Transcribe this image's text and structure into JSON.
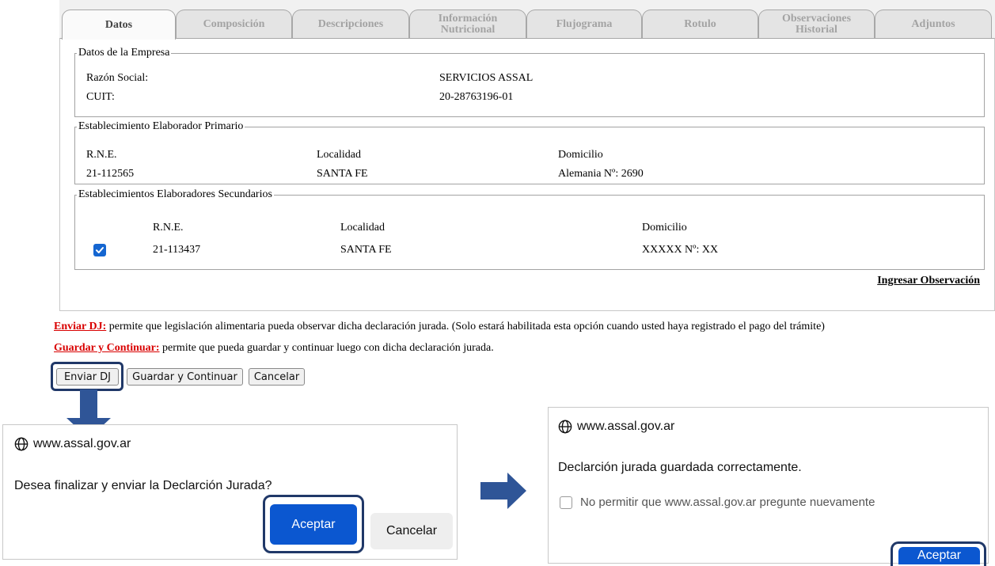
{
  "tabs": [
    {
      "label": "Datos",
      "active": true
    },
    {
      "label": "Composición"
    },
    {
      "label": "Descripciones"
    },
    {
      "label_line1": "Información",
      "label_line2": "Nutricional"
    },
    {
      "label": "Flujograma"
    },
    {
      "label": "Rotulo"
    },
    {
      "label_line1": "Observaciones",
      "label_line2": "Historial"
    },
    {
      "label": "Adjuntos"
    }
  ],
  "empresa": {
    "legend": "Datos de la Empresa",
    "razon_social_label": "Razón Social:",
    "razon_social_value": "SERVICIOS ASSAL",
    "cuit_label": "CUIT:",
    "cuit_value": "20-28763196-01"
  },
  "primario": {
    "legend": "Establecimiento Elaborador Primario",
    "headers": {
      "rne": "R.N.E.",
      "localidad": "Localidad",
      "domicilio": "Domicilio"
    },
    "row": {
      "rne": "21-112565",
      "localidad": "SANTA FE",
      "domicilio": "Alemania Nº: 2690"
    }
  },
  "secundarios": {
    "legend": "Establecimientos Elaboradores Secundarios",
    "headers": {
      "rne": "R.N.E.",
      "localidad": "Localidad",
      "domicilio": "Domicilio"
    },
    "rows": [
      {
        "checked": true,
        "rne": "21-113437",
        "localidad": "SANTA FE",
        "domicilio": "XXXXX Nº: XX"
      }
    ]
  },
  "ingresar_observacion": "Ingresar Observación",
  "help": {
    "enviar_link": "Enviar DJ:",
    "enviar_text": " permite que legislación alimentaria pueda observar dicha declaración jurada. (Solo estará habilitada esta opción cuando usted haya registrado el pago del trámite)",
    "guardar_link": "Guardar y Continuar:",
    "guardar_text": " permite que pueda guardar y continuar luego con dicha declaración jurada."
  },
  "buttons": {
    "enviar": "Enviar DJ",
    "guardar": "Guardar y Continuar",
    "cancelar": "Cancelar"
  },
  "dialog_confirm": {
    "origin": "www.assal.gov.ar",
    "message": "Desea finalizar y enviar la Declarción Jurada?",
    "accept": "Aceptar",
    "cancel": "Cancelar"
  },
  "dialog_saved": {
    "origin": "www.assal.gov.ar",
    "message": "Declarción jurada guardada correctamente.",
    "checkbox_label": "No permitir que www.assal.gov.ar pregunte nuevamente",
    "accept": "Aceptar"
  },
  "colors": {
    "accent_blue": "#0b57d0",
    "highlight_navy": "#203868",
    "link_red": "#d90000",
    "arrow_blue": "#2f5597"
  }
}
